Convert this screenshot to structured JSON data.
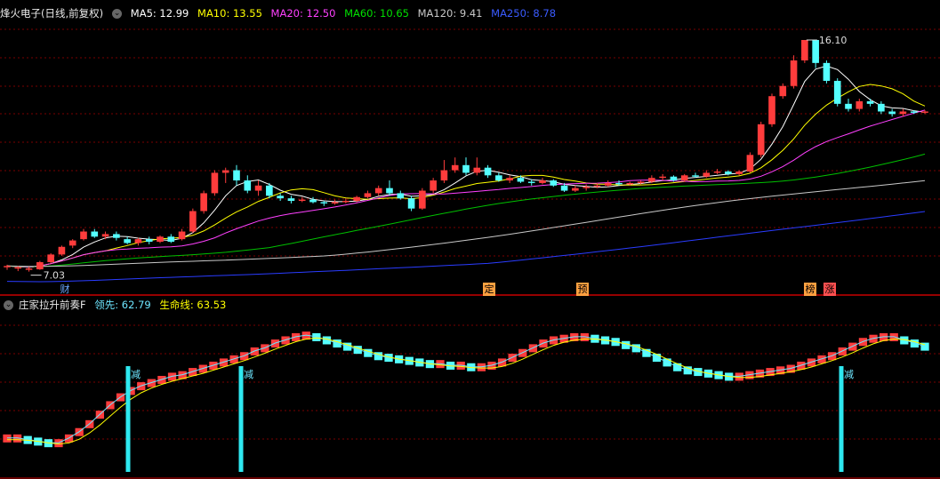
{
  "header": {
    "stock_title": "烽火电子(日线,前复权)",
    "ma_labels": [
      {
        "text": "MA5: 12.99",
        "color": "#ffffff"
      },
      {
        "text": "MA10: 13.55",
        "color": "#ffff00"
      },
      {
        "text": "MA20: 12.50",
        "color": "#ff40ff"
      },
      {
        "text": "MA60: 10.65",
        "color": "#00e000"
      },
      {
        "text": "MA120: 9.41",
        "color": "#c8c8c8"
      },
      {
        "text": "MA250: 8.78",
        "color": "#3a5bff"
      }
    ]
  },
  "indicator_header": {
    "title": "庄家拉升前奏F",
    "lead_label": "领先: 62.79",
    "life_label": "生命线: 63.53",
    "lead_color": "#6ee6ff",
    "life_color": "#ffff00"
  },
  "markers": [
    {
      "text": "财",
      "color": "#6aa8ff"
    },
    {
      "text": "定",
      "color": "#ffa040"
    },
    {
      "text": "预",
      "color": "#ffa040"
    },
    {
      "text": "榜",
      "color": "#ffa040"
    },
    {
      "text": "涨",
      "color": "#ff5050"
    }
  ],
  "annotations": {
    "high": "16.10",
    "low": "7.03",
    "signal": "减"
  },
  "colors": {
    "up": "#ff3c3c",
    "down": "#54ffff",
    "grid": "#7a0000",
    "axis": "#c80000"
  },
  "chart_data": {
    "type": "candlestick",
    "price_range": [
      6.6,
      16.9
    ],
    "candles": [
      [
        7.2,
        7.25,
        7.1,
        7.3
      ],
      [
        7.15,
        7.2,
        7.05,
        7.25
      ],
      [
        7.1,
        7.15,
        7.03,
        7.22
      ],
      [
        7.12,
        7.4,
        7.1,
        7.45
      ],
      [
        7.4,
        7.7,
        7.35,
        7.75
      ],
      [
        7.7,
        8.0,
        7.65,
        8.05
      ],
      [
        8.05,
        8.25,
        7.95,
        8.3
      ],
      [
        8.3,
        8.6,
        8.25,
        8.7
      ],
      [
        8.6,
        8.4,
        8.35,
        8.7
      ],
      [
        8.4,
        8.5,
        8.3,
        8.6
      ],
      [
        8.5,
        8.35,
        8.25,
        8.6
      ],
      [
        8.3,
        8.15,
        8.1,
        8.4
      ],
      [
        8.15,
        8.3,
        8.05,
        8.35
      ],
      [
        8.3,
        8.2,
        8.1,
        8.4
      ],
      [
        8.2,
        8.4,
        8.15,
        8.45
      ],
      [
        8.4,
        8.2,
        8.15,
        8.5
      ],
      [
        8.3,
        8.6,
        8.25,
        8.7
      ],
      [
        8.6,
        9.4,
        8.55,
        9.5
      ],
      [
        9.4,
        10.1,
        9.3,
        10.2
      ],
      [
        10.1,
        10.9,
        10.0,
        11.0
      ],
      [
        10.9,
        11.0,
        10.5,
        11.1
      ],
      [
        11.0,
        10.6,
        10.4,
        11.2
      ],
      [
        10.6,
        10.2,
        10.1,
        10.8
      ],
      [
        10.2,
        10.4,
        10.0,
        10.6
      ],
      [
        10.4,
        10.0,
        9.9,
        10.5
      ],
      [
        10.0,
        9.9,
        9.8,
        10.1
      ],
      [
        9.9,
        9.8,
        9.7,
        10.0
      ],
      [
        9.8,
        9.85,
        9.75,
        9.95
      ],
      [
        9.85,
        9.75,
        9.7,
        9.95
      ],
      [
        9.75,
        9.7,
        9.6,
        9.8
      ],
      [
        9.7,
        9.75,
        9.65,
        9.85
      ],
      [
        9.75,
        9.8,
        9.7,
        9.9
      ],
      [
        9.8,
        9.95,
        9.75,
        10.0
      ],
      [
        9.95,
        10.1,
        9.9,
        10.2
      ],
      [
        10.1,
        10.3,
        10.0,
        10.4
      ],
      [
        10.3,
        10.1,
        10.0,
        10.6
      ],
      [
        10.1,
        9.9,
        9.85,
        10.2
      ],
      [
        9.9,
        9.5,
        9.4,
        10.0
      ],
      [
        9.5,
        10.2,
        9.45,
        10.3
      ],
      [
        10.2,
        10.6,
        10.1,
        10.7
      ],
      [
        10.6,
        11.0,
        10.5,
        11.4
      ],
      [
        11.0,
        11.2,
        10.9,
        11.5
      ],
      [
        11.2,
        10.9,
        10.8,
        11.5
      ],
      [
        10.9,
        11.1,
        10.8,
        11.5
      ],
      [
        11.1,
        10.8,
        10.7,
        11.2
      ],
      [
        10.8,
        10.6,
        10.55,
        10.9
      ],
      [
        10.6,
        10.7,
        10.5,
        10.8
      ],
      [
        10.7,
        10.55,
        10.5,
        10.8
      ],
      [
        10.55,
        10.5,
        10.4,
        10.65
      ],
      [
        10.5,
        10.6,
        10.45,
        10.7
      ],
      [
        10.6,
        10.4,
        10.35,
        10.65
      ],
      [
        10.4,
        10.2,
        10.15,
        10.5
      ],
      [
        10.2,
        10.3,
        10.15,
        10.4
      ],
      [
        10.3,
        10.35,
        10.2,
        10.45
      ],
      [
        10.35,
        10.4,
        10.3,
        10.5
      ],
      [
        10.4,
        10.5,
        10.35,
        10.6
      ],
      [
        10.5,
        10.45,
        10.4,
        10.6
      ],
      [
        10.45,
        10.5,
        10.4,
        10.55
      ],
      [
        10.5,
        10.55,
        10.45,
        10.6
      ],
      [
        10.55,
        10.7,
        10.5,
        10.8
      ],
      [
        10.7,
        10.75,
        10.6,
        10.85
      ],
      [
        10.75,
        10.6,
        10.55,
        10.8
      ],
      [
        10.6,
        10.8,
        10.55,
        10.85
      ],
      [
        10.8,
        10.75,
        10.7,
        10.9
      ],
      [
        10.75,
        10.9,
        10.7,
        11.0
      ],
      [
        10.9,
        10.95,
        10.85,
        11.05
      ],
      [
        10.95,
        10.85,
        10.8,
        11.0
      ],
      [
        10.85,
        10.95,
        10.8,
        11.0
      ],
      [
        10.95,
        11.6,
        10.9,
        11.7
      ],
      [
        11.6,
        12.8,
        11.5,
        12.9
      ],
      [
        12.8,
        13.9,
        12.7,
        14.0
      ],
      [
        13.9,
        14.3,
        13.8,
        14.4
      ],
      [
        14.3,
        15.3,
        14.2,
        15.5
      ],
      [
        15.3,
        16.1,
        15.2,
        16.1
      ],
      [
        16.1,
        15.2,
        15.0,
        16.0
      ],
      [
        15.2,
        14.5,
        14.4,
        15.3
      ],
      [
        14.5,
        13.6,
        13.5,
        14.6
      ],
      [
        13.6,
        13.4,
        13.3,
        13.8
      ],
      [
        13.4,
        13.7,
        13.3,
        13.8
      ],
      [
        13.7,
        13.6,
        13.5,
        13.8
      ],
      [
        13.6,
        13.3,
        13.2,
        13.7
      ],
      [
        13.3,
        13.2,
        13.1,
        13.4
      ],
      [
        13.2,
        13.3,
        13.1,
        13.4
      ],
      [
        13.3,
        13.25,
        13.2,
        13.35
      ],
      [
        13.25,
        13.3,
        13.2,
        13.35
      ]
    ],
    "indicator": {
      "range": [
        0,
        100
      ],
      "bars": [
        [
          22,
          22
        ],
        [
          22,
          22
        ],
        [
          21,
          21
        ],
        [
          20,
          20
        ],
        [
          19,
          19
        ],
        [
          19,
          19
        ],
        [
          22,
          22
        ],
        [
          26,
          26
        ],
        [
          31,
          31
        ],
        [
          37,
          37
        ],
        [
          43,
          43
        ],
        [
          48,
          48
        ],
        [
          52,
          52
        ],
        [
          55,
          55
        ],
        [
          57,
          57
        ],
        [
          59,
          59
        ],
        [
          61,
          61
        ],
        [
          62,
          62
        ],
        [
          64,
          64
        ],
        [
          66,
          66
        ],
        [
          68,
          68
        ],
        [
          70,
          70
        ],
        [
          72,
          72
        ],
        [
          74,
          74
        ],
        [
          77,
          77
        ],
        [
          79,
          79
        ],
        [
          82,
          82
        ],
        [
          84,
          84
        ],
        [
          86,
          86
        ],
        [
          87,
          87
        ],
        [
          86,
          86
        ],
        [
          84,
          84
        ],
        [
          82,
          82
        ],
        [
          80,
          80
        ],
        [
          78,
          78
        ],
        [
          76,
          76
        ],
        [
          74,
          74
        ],
        [
          73,
          73
        ],
        [
          72,
          72
        ],
        [
          71,
          71
        ],
        [
          70,
          70
        ],
        [
          69,
          69
        ],
        [
          69,
          69
        ],
        [
          68,
          68
        ],
        [
          68,
          68
        ],
        [
          67,
          67
        ],
        [
          67,
          67
        ],
        [
          68,
          68
        ],
        [
          70,
          70
        ],
        [
          73,
          73
        ],
        [
          76,
          76
        ],
        [
          79,
          79
        ],
        [
          82,
          82
        ],
        [
          84,
          84
        ],
        [
          85,
          85
        ],
        [
          86,
          86
        ],
        [
          86,
          86
        ],
        [
          85,
          85
        ],
        [
          84,
          84
        ],
        [
          83,
          83
        ],
        [
          81,
          81
        ],
        [
          79,
          79
        ],
        [
          76,
          76
        ],
        [
          73,
          73
        ],
        [
          70,
          70
        ],
        [
          67,
          67
        ],
        [
          65,
          65
        ],
        [
          64,
          64
        ],
        [
          63,
          63
        ],
        [
          62,
          62
        ],
        [
          61,
          61
        ],
        [
          61,
          61
        ],
        [
          62,
          62
        ],
        [
          63,
          63
        ],
        [
          64,
          64
        ],
        [
          65,
          65
        ],
        [
          66,
          66
        ],
        [
          68,
          68
        ],
        [
          70,
          70
        ],
        [
          72,
          72
        ],
        [
          74,
          74
        ],
        [
          77,
          77
        ],
        [
          80,
          80
        ],
        [
          83,
          83
        ],
        [
          85,
          85
        ],
        [
          86,
          86
        ],
        [
          86,
          86
        ],
        [
          84,
          84
        ],
        [
          82,
          82
        ],
        [
          80,
          80
        ]
      ]
    }
  }
}
